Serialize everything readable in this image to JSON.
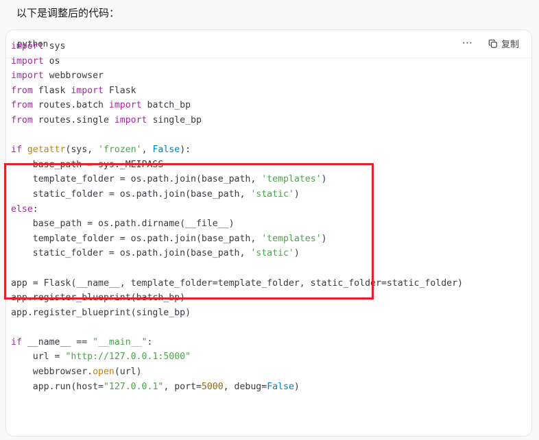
{
  "intro_text": "以下是调整后的代码：",
  "code_block": {
    "language": "python",
    "more_icon": "ellipsis-icon",
    "copy_label": "复制",
    "copy_icon": "copy-icon"
  },
  "code_lines": [
    [
      [
        "kw",
        "import"
      ],
      [
        "p",
        " sys"
      ]
    ],
    [
      [
        "kw",
        "import"
      ],
      [
        "p",
        " os"
      ]
    ],
    [
      [
        "kw",
        "import"
      ],
      [
        "p",
        " webbrowser"
      ]
    ],
    [
      [
        "kw",
        "from"
      ],
      [
        "p",
        " flask "
      ],
      [
        "kw",
        "import"
      ],
      [
        "p",
        " Flask"
      ]
    ],
    [
      [
        "kw",
        "from"
      ],
      [
        "p",
        " routes.batch "
      ],
      [
        "kw",
        "import"
      ],
      [
        "p",
        " batch_bp"
      ]
    ],
    [
      [
        "kw",
        "from"
      ],
      [
        "p",
        " routes.single "
      ],
      [
        "kw",
        "import"
      ],
      [
        "p",
        " single_bp"
      ]
    ],
    [],
    [
      [
        "kw",
        "if"
      ],
      [
        "p",
        " "
      ],
      [
        "fn",
        "getattr"
      ],
      [
        "p",
        "(sys, "
      ],
      [
        "str",
        "'frozen'"
      ],
      [
        "p",
        ", "
      ],
      [
        "bool",
        "False"
      ],
      [
        "p",
        "):"
      ]
    ],
    [
      [
        "p",
        "    base_path = sys._MEIPASS"
      ]
    ],
    [
      [
        "p",
        "    template_folder = os.path.join(base_path, "
      ],
      [
        "str",
        "'templates'"
      ],
      [
        "p",
        ")"
      ]
    ],
    [
      [
        "p",
        "    static_folder = os.path.join(base_path, "
      ],
      [
        "str",
        "'static'"
      ],
      [
        "p",
        ")"
      ]
    ],
    [
      [
        "kw",
        "else"
      ],
      [
        "p",
        ":"
      ]
    ],
    [
      [
        "p",
        "    base_path = os.path.dirname(__file__)"
      ]
    ],
    [
      [
        "p",
        "    template_folder = os.path.join(base_path, "
      ],
      [
        "str",
        "'templates'"
      ],
      [
        "p",
        ")"
      ]
    ],
    [
      [
        "p",
        "    static_folder = os.path.join(base_path, "
      ],
      [
        "str",
        "'static'"
      ],
      [
        "p",
        ")"
      ]
    ],
    [],
    [
      [
        "p",
        "app = Flask(__name__, template_folder=template_folder, static_folder=static_folder)"
      ]
    ],
    [
      [
        "p",
        "app.register_blueprint(batch_bp)"
      ]
    ],
    [
      [
        "p",
        "app.register_blueprint(single_bp)"
      ]
    ],
    [],
    [
      [
        "kw",
        "if"
      ],
      [
        "p",
        " __name__ == "
      ],
      [
        "str",
        "\"__main__\""
      ],
      [
        "p",
        ":"
      ]
    ],
    [
      [
        "p",
        "    url = "
      ],
      [
        "str",
        "\"http://127.0.0.1:5000\""
      ]
    ],
    [
      [
        "p",
        "    webbrowser."
      ],
      [
        "fn",
        "open"
      ],
      [
        "p",
        "(url)"
      ]
    ],
    [
      [
        "p",
        "    app.run(host="
      ],
      [
        "str",
        "\"127.0.0.1\""
      ],
      [
        "p",
        ", port="
      ],
      [
        "num",
        "5000"
      ],
      [
        "p",
        ", debug="
      ],
      [
        "bool",
        "False"
      ],
      [
        "p",
        ")"
      ]
    ]
  ],
  "colors": {
    "keyword": "#a626a4",
    "string": "#50a14f",
    "builtin": "#c18401",
    "number": "#986801",
    "boolean": "#0184bc",
    "highlight_border": "#e5202a"
  }
}
